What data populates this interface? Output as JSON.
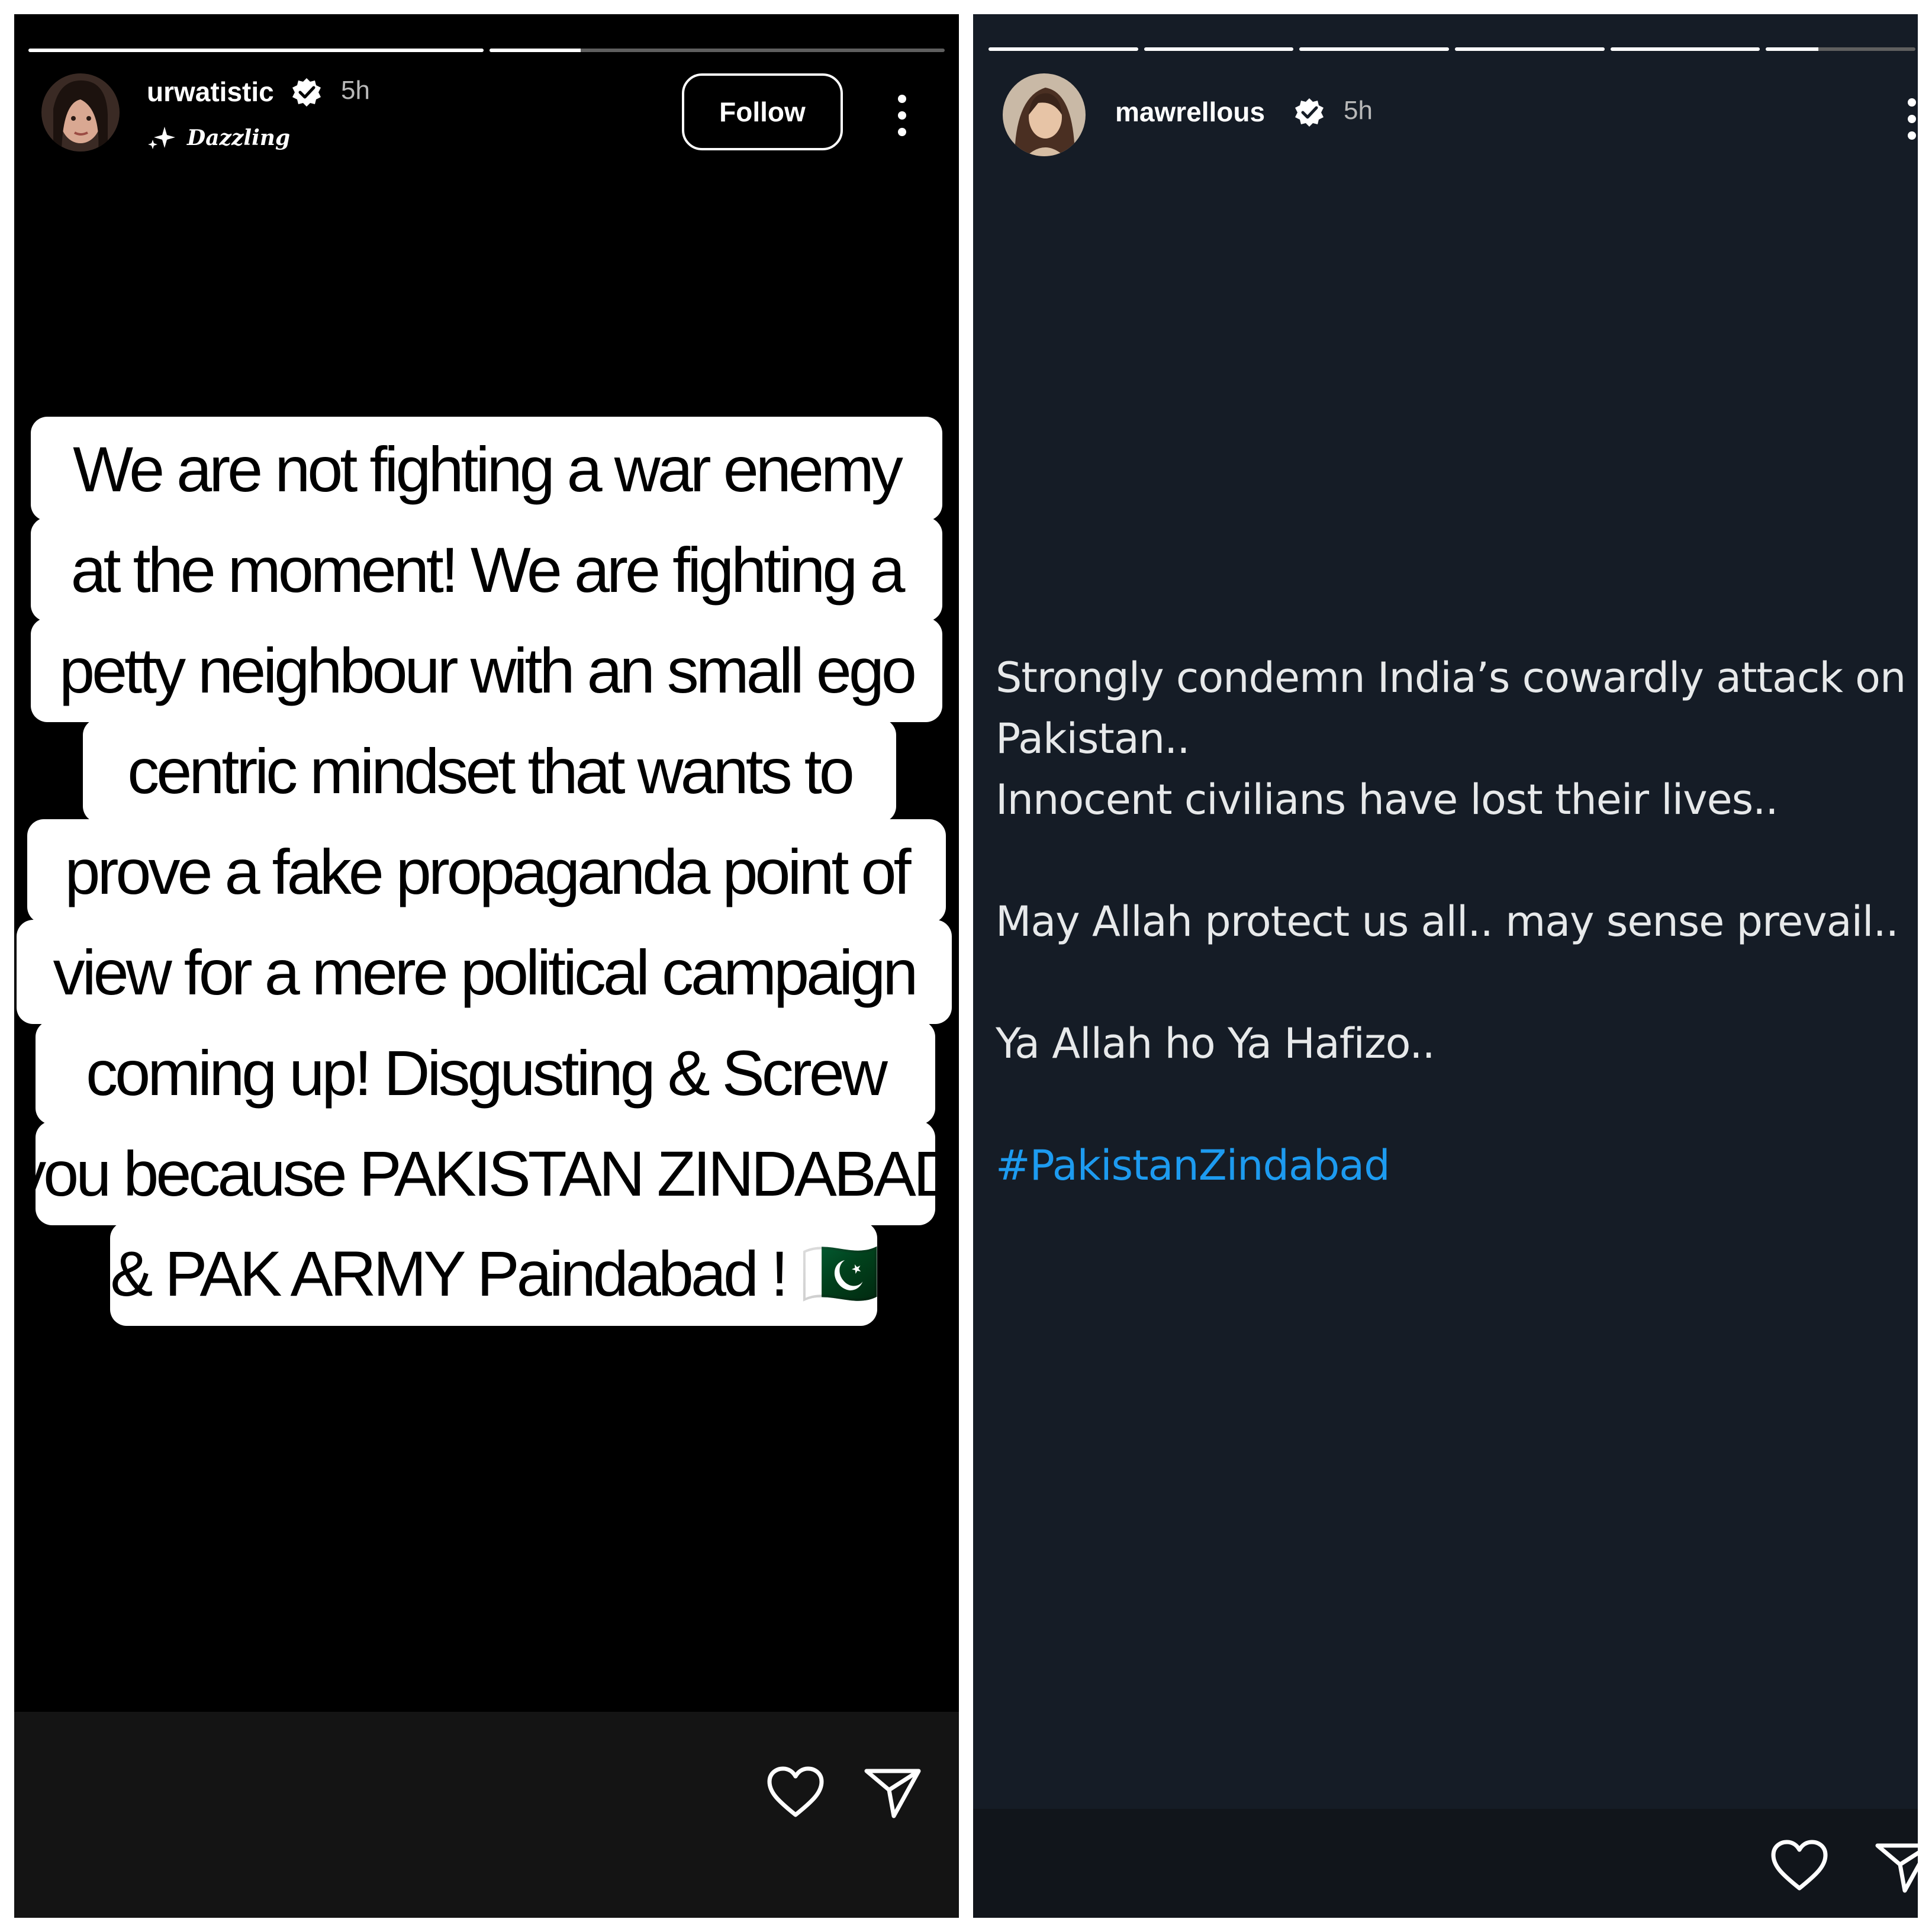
{
  "left_story": {
    "username": "urwatistic",
    "time": "5h",
    "subtitle": "Dazzling",
    "follow_label": "Follow",
    "progress": [
      1.0,
      0.2
    ],
    "text_lines": [
      "We are not fighting a war enemy",
      "at the moment! We are fighting a",
      "petty neighbour with an small ego",
      "centric mindset that wants to",
      "prove a fake propaganda point of",
      "view for a mere political campaign",
      "coming up! Disgusting & Screw",
      "you because PAKISTAN ZINDABAD",
      "& PAK ARMY Paindabad ! 🇵🇰"
    ]
  },
  "right_story": {
    "username": "mawrellous",
    "time": "5h",
    "progress": [
      1.0,
      1.0,
      1.0,
      1.0,
      1.0,
      0.35
    ],
    "post_lines": [
      "Strongly condemn India’s cowardly attack on",
      "Pakistan..",
      "Innocent civilians have lost their lives..",
      "",
      "May Allah protect us all.. may sense prevail..",
      "",
      "Ya Allah ho Ya Hafizo..",
      ""
    ],
    "hashtag": "#PakistanZindabad"
  },
  "icons": {
    "verified": "verified-badge-icon",
    "more": "more-vertical-icon",
    "like": "heart-icon",
    "share": "send-icon",
    "sparkle": "sparkles-icon"
  }
}
